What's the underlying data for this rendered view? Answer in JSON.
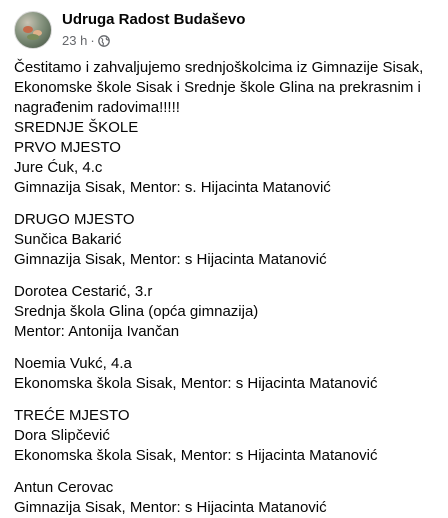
{
  "post": {
    "page_name": "Udruga Radost Budaševo",
    "timestamp": "23 h",
    "separator": "·",
    "privacy_icon": "globe-icon",
    "intro": "Čestitamo i zahvaljujemo srednjoškolcima iz Gimnazije Sisak, Ekonomske škole Sisak i Srednje škole Glina na prekrasnim i nagrađenim radovima!!!!!",
    "blocks": [
      [
        "SREDNJE ŠKOLE",
        "PRVO MJESTO",
        "Jure Ćuk, 4.c",
        "Gimnazija Sisak, Mentor: s. Hijacinta Matanović"
      ],
      [
        "DRUGO MJESTO",
        "Sunčica Bakarić",
        "Gimnazija Sisak, Mentor: s Hijacinta Matanović"
      ],
      [
        "Dorotea Cestarić, 3.r",
        "Srednja škola Glina (opća gimnazija)",
        "Mentor: Antonija Ivančan"
      ],
      [
        "Noemia Vukć, 4.a",
        "Ekonomska škola Sisak, Mentor: s Hijacinta Matanović"
      ],
      [
        "TREĆE MJESTO",
        "Dora Slipčević",
        "Ekonomska škola Sisak, Mentor: s Hijacinta Matanović"
      ],
      [
        "Antun Cerovac",
        "Gimnazija Sisak, Mentor: s Hijacinta Matanović"
      ]
    ]
  }
}
